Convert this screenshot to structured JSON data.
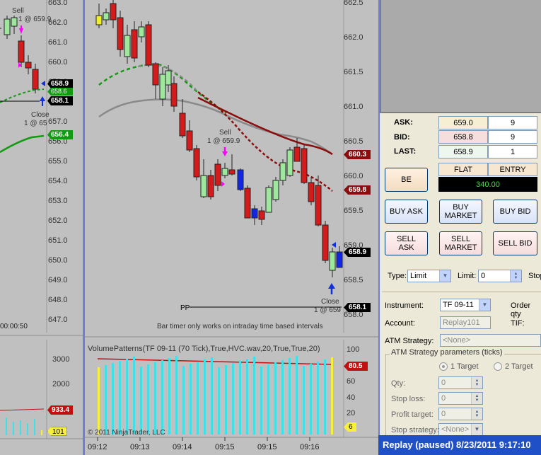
{
  "left_chart": {
    "axis_ticks": [
      "663.0",
      "662.0",
      "661.0",
      "660.0",
      "659.0",
      "658.0",
      "657.0",
      "656.0",
      "655.0",
      "654.0",
      "653.0",
      "652.0",
      "651.0",
      "650.0",
      "649.0",
      "648.0",
      "647.0"
    ],
    "sell_label": "Sell",
    "sell_price": "1 @ 659.9",
    "close_label": "Close",
    "close_price": "1 @ 659",
    "price_tags": [
      "658.9",
      "658.6",
      "658.1",
      "656.4"
    ],
    "timer": "00:00:50",
    "volume_ticks": [
      "3000",
      "2000",
      "1000"
    ],
    "volume_tags": [
      "933.4",
      "101"
    ]
  },
  "main_chart": {
    "axis_ticks": [
      "662.5",
      "662.0",
      "661.5",
      "661.0",
      "660.5",
      "660.0",
      "659.5",
      "659.0",
      "658.5",
      "658.0"
    ],
    "sell_label": "Sell",
    "sell_price": "1 @ 659.9",
    "close_label": "Close",
    "close_price": "1 @ 659",
    "pp_label": "PP",
    "price_tags": {
      "a": "660.3",
      "b": "659.8",
      "c": "658.9",
      "d": "658.1"
    },
    "bar_timer_msg": "Bar timer only works on intraday time based intervals",
    "volume_title": "VolumePatterns(TF 09-11 (70 Tick),True,HVC.wav,20,True,True,20)",
    "volume_ticks": [
      "100",
      "80",
      "60",
      "40",
      "20"
    ],
    "volume_tags": {
      "a": "80.5",
      "b": "6"
    },
    "copyright": "© 2011 NinjaTrader, LLC",
    "time_labels": [
      "09:12",
      "09:13",
      "09:14",
      "09:15",
      "09:15",
      "09:16"
    ]
  },
  "order_panel": {
    "ask_label": "ASK:",
    "bid_label": "BID:",
    "last_label": "LAST:",
    "ask": "659.0",
    "ask_size": "9",
    "bid": "658.8",
    "bid_size": "9",
    "last": "658.9",
    "last_size": "1",
    "flat": "FLAT",
    "entry": "ENTRY",
    "pnl": "340.00",
    "be_button": "BE",
    "buy_ask": "BUY ASK",
    "buy_market": "BUY MARKET",
    "buy_bid": "BUY BID",
    "sell_ask": "SELL ASK",
    "sell_market": "SELL MARKET",
    "sell_bid": "SELL BID",
    "type_label": "Type:",
    "type_value": "Limit",
    "limit_label": "Limit:",
    "limit_value": "0",
    "stop_label": "Stop",
    "instrument_label": "Instrument:",
    "instrument_value": "TF 09-11",
    "order_qty_label": "Order qty",
    "account_label": "Account:",
    "account_value": "Replay101",
    "tif_label": "TIF:",
    "atm_label": "ATM Strategy:",
    "atm_value": "<None>",
    "atm_group": "ATM Strategy parameters (ticks)",
    "one_target": "1 Target",
    "two_target": "2 Target",
    "qty_label": "Qty:",
    "qty_value": "0",
    "stop_loss_label": "Stop loss:",
    "stop_loss_value": "0",
    "profit_target_label": "Profit target:",
    "profit_target_value": "0",
    "stop_strategy_label": "Stop strategy:",
    "stop_strategy_value": "<None>"
  },
  "status_bar": "Replay (paused) 8/23/2011 9:17:10",
  "colors": {
    "up": "#9ee89e",
    "down": "#d41a1a",
    "blue_bar": "#1226e6",
    "ema_red": "#8b0d0d",
    "sma_gray": "#8a8a8a",
    "ema_green": "#139a13",
    "vol_cyan": "#40e0e8",
    "vol_yellow": "#f7f03a"
  }
}
